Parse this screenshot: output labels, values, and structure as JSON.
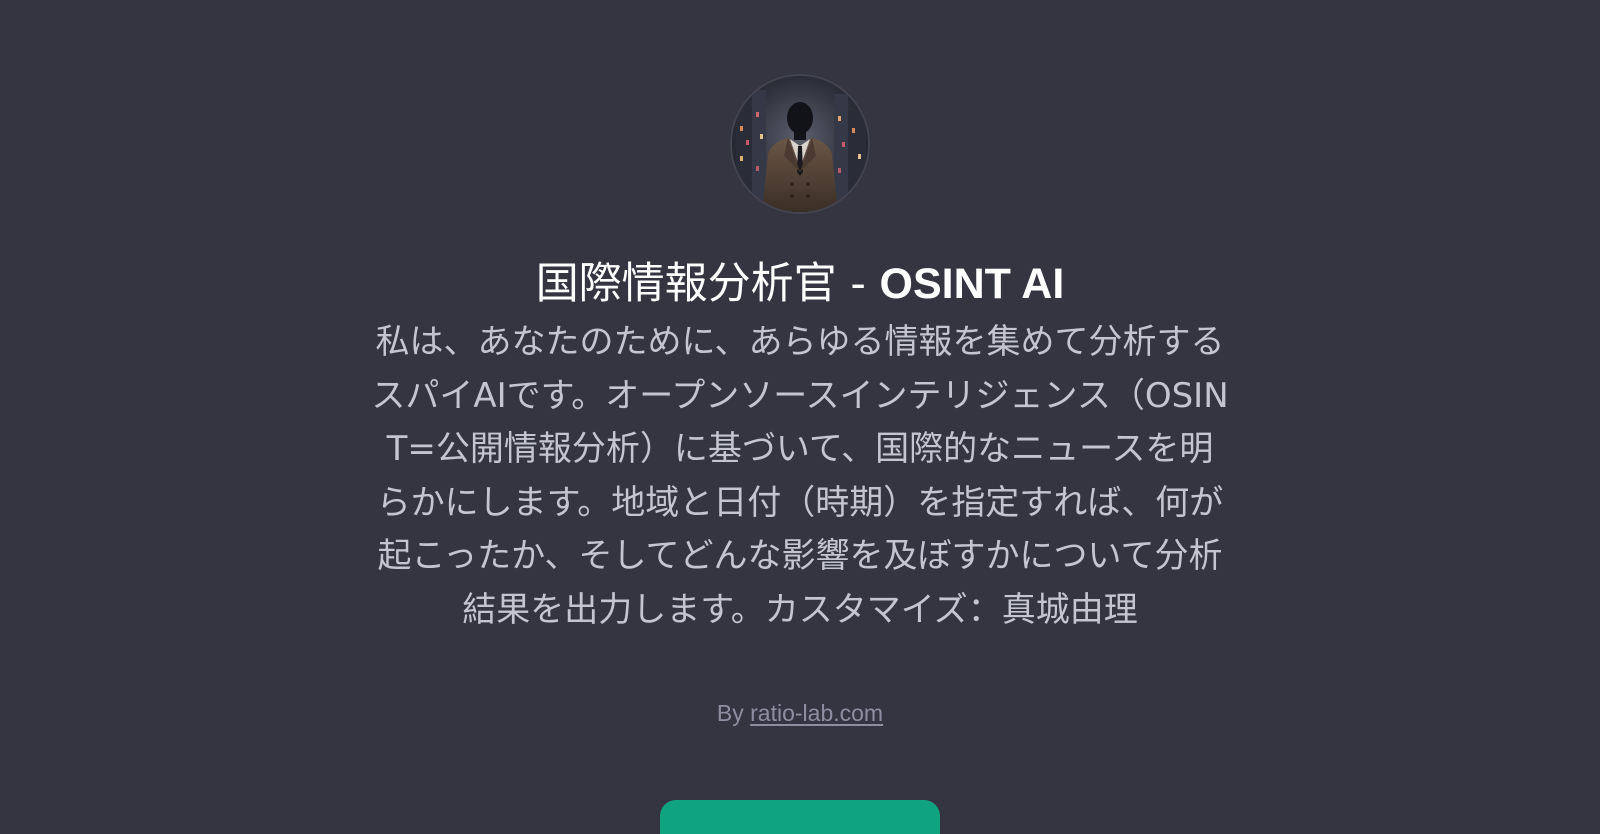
{
  "gpt": {
    "avatar_icon": "spy-silhouette-avatar",
    "title_prefix": "国際情報分析官 - ",
    "title_suffix": "OSINT AI",
    "description": "私は、あなたのために、あらゆる情報を集めて分析するスパイAIです。オープンソースインテリジェンス（OSINT=公開情報分析）に基づいて、国際的なニュースを明らかにします。地域と日付（時期）を指定すれば、何が起こったか、そしてどんな影響を及ぼすかについて分析結果を出力します。カスタマイズ：真城由理",
    "byline_prefix": "By ",
    "author_link": "ratio-lab.com"
  },
  "colors": {
    "background": "#343541",
    "title": "#ffffff",
    "description": "#c5c5d2",
    "byline": "#8e8ea0",
    "accent": "#10a37f"
  }
}
